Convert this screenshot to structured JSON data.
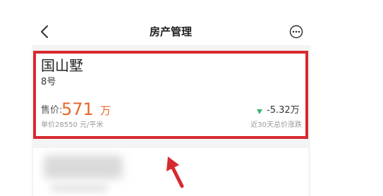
{
  "header": {
    "title": "房产管理",
    "back_icon": "chevron-left-icon",
    "more_icon": "more-icon"
  },
  "property": {
    "name": "国山墅",
    "unit": "8号",
    "price_label": "售价:",
    "price_value": "571",
    "price_unit": "万",
    "unit_price": "单价28550 元/平米",
    "change_icon": "triangle-down-icon",
    "change_value": "-5.32万",
    "change_label": "近30天总价涨跌"
  },
  "colors": {
    "price": "#e8652b",
    "change_down": "#3fb56d",
    "highlight": "#d62a2f"
  }
}
